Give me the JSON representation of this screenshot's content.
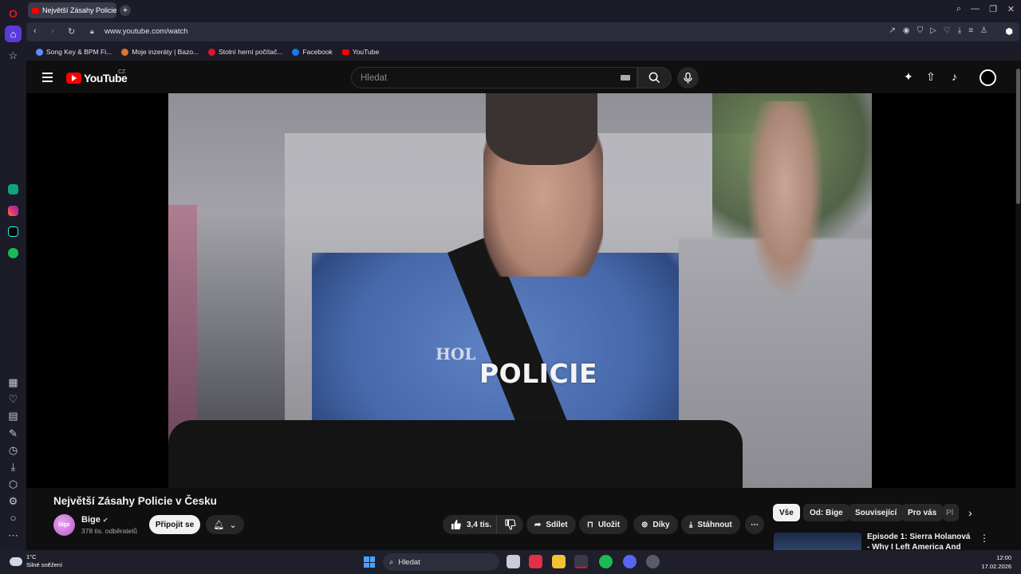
{
  "browser": {
    "tab_title": "Největší Zásahy Policie v Č",
    "url": "www.youtube.com/watch",
    "bookmarks": [
      {
        "label": "Song Key & BPM Fi...",
        "color": "#5b8cff"
      },
      {
        "label": "Moje inzeráty | Bazo...",
        "color": "#e0742b"
      },
      {
        "label": "Stolní herní počítač...",
        "color": "#e0142b"
      },
      {
        "label": "Facebook",
        "color": "#1877f2"
      },
      {
        "label": "YouTube",
        "color": "#ff0000"
      }
    ]
  },
  "youtube": {
    "logo_text": "YouTube",
    "country_code": "CZ",
    "search_placeholder": "Hledat"
  },
  "video": {
    "overlay_text": "POLICIE",
    "shirt_text": "HOL",
    "title": "Největší Zásahy Policie v Česku",
    "channel": {
      "name": "Bige",
      "avatar_text": "bige",
      "subscribers": "378 tis. odběratelů",
      "join_label": "Připojit se"
    },
    "actions": {
      "likes": "3,4 tis.",
      "share": "Sdílet",
      "save": "Uložit",
      "thanks": "Díky",
      "download": "Stáhnout"
    }
  },
  "sidebar_chips": [
    "Vše",
    "Od: Bige",
    "Související",
    "Pro vás",
    "Pl"
  ],
  "recommendation": {
    "title": "Episode 1: Sierra Holanová - Why I Left America And"
  },
  "taskbar": {
    "temperature": "1°C",
    "weather": "Silné sněžení",
    "search_label": "Hledat",
    "time": "12:00",
    "date": "17.02.2026"
  },
  "colors": {
    "accent": "#ff0000",
    "opera_red": "#e0142b",
    "background": "#0f0f0f"
  }
}
